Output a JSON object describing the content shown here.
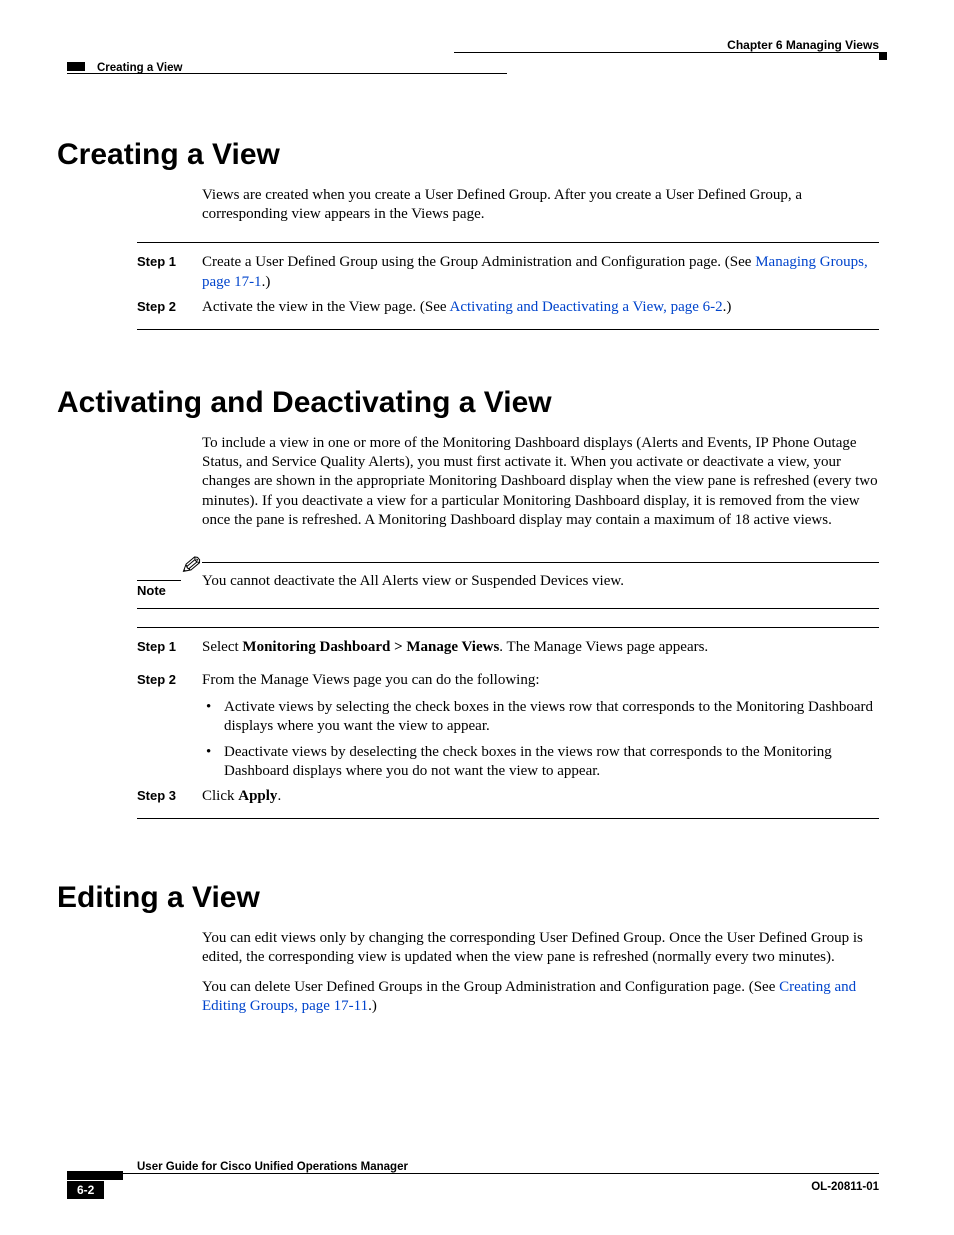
{
  "header": {
    "chapter": "Chapter 6      Managing Views",
    "section": "Creating a View"
  },
  "section1": {
    "heading": "Creating a View",
    "intro": "Views are created when you create a User Defined Group. After you create a User Defined Group, a corresponding view appears in the Views page.",
    "step1": {
      "label": "Step 1",
      "text_before_link": "Create a User Defined Group using the Group Administration and Configuration page. (See ",
      "link": "Managing Groups, page 17-1",
      "text_after_link": ".)"
    },
    "step2": {
      "label": "Step 2",
      "text_before_link": "Activate the view in the View page. (See ",
      "link": "Activating and Deactivating a View, page 6-2",
      "text_after_link": ".)"
    }
  },
  "section2": {
    "heading": "Activating and Deactivating a View",
    "intro": "To include a view in one or more of the Monitoring Dashboard displays (Alerts and Events, IP Phone Outage Status, and Service Quality Alerts), you must first activate it. When you activate or deactivate a view, your changes are shown in the appropriate Monitoring Dashboard display when the view pane is refreshed (every two minutes). If you deactivate a view for a particular Monitoring Dashboard display, it is removed from the view once the pane is refreshed. A Monitoring Dashboard display may contain a maximum of 18 active views.",
    "note_label": "Note",
    "note_text": "You cannot deactivate the All Alerts view or Suspended Devices view.",
    "step1": {
      "label": "Step 1",
      "prefix": "Select ",
      "bold": "Monitoring Dashboard > Manage Views",
      "suffix": ". The Manage Views page appears."
    },
    "step2": {
      "label": "Step 2",
      "text": "From the Manage Views page you can do the following:",
      "bullet1": "Activate views by selecting the check boxes in the views row that corresponds to the Monitoring Dashboard displays where you want the view to appear.",
      "bullet2": "Deactivate views by deselecting the  check boxes in the views row that corresponds to the Monitoring Dashboard displays where you do not want the view to appear."
    },
    "step3": {
      "label": "Step 3",
      "prefix": "Click ",
      "bold": "Apply",
      "suffix": "."
    }
  },
  "section3": {
    "heading": "Editing a View",
    "para1": "You can edit views only by changing the corresponding User Defined Group. Once the User Defined Group is edited, the corresponding view is updated when the view pane is refreshed (normally every two minutes).",
    "para2_before": "You can delete User Defined Groups in the Group Administration and Configuration page. (See ",
    "para2_link": "Creating and Editing Groups, page 17-11",
    "para2_after": ".)"
  },
  "footer": {
    "doc_title": "User Guide for Cisco Unified Operations Manager",
    "page_num": "6-2",
    "doc_id": "OL-20811-01"
  }
}
